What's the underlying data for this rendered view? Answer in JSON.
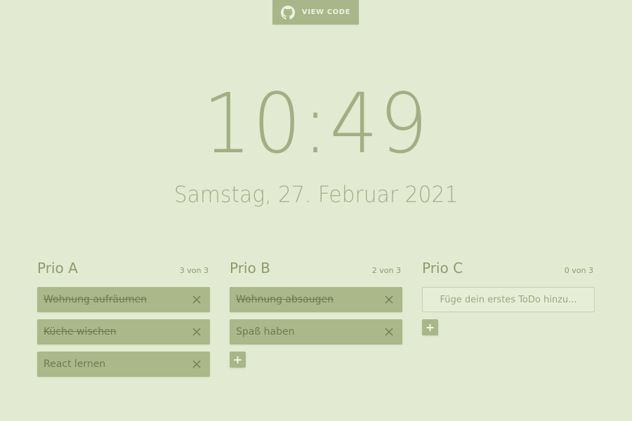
{
  "header": {
    "view_code_label": "VIEW CODE",
    "github_icon": "github-icon"
  },
  "clock": {
    "time": "10:49",
    "date": "Samstag, 27. Februar 2021"
  },
  "columns": [
    {
      "title": "Prio A",
      "count": "3 von 3",
      "todos": [
        {
          "text": "Wohnung aufräumen",
          "done": true
        },
        {
          "text": "Küche wischen",
          "done": true
        },
        {
          "text": "React lernen",
          "done": false
        }
      ]
    },
    {
      "title": "Prio B",
      "count": "2 von 3",
      "todos": [
        {
          "text": "Wohnung absaugen",
          "done": true
        },
        {
          "text": "Spaß haben",
          "done": false
        }
      ]
    },
    {
      "title": "Prio C",
      "count": "0 von 3",
      "input_placeholder": "Füge dein erstes ToDo hinzu...",
      "todos": []
    }
  ],
  "add_button_label": "+",
  "colors": {
    "background": "#e2ebd2",
    "accent": "#a9b688",
    "text": "#8e9a6c"
  }
}
